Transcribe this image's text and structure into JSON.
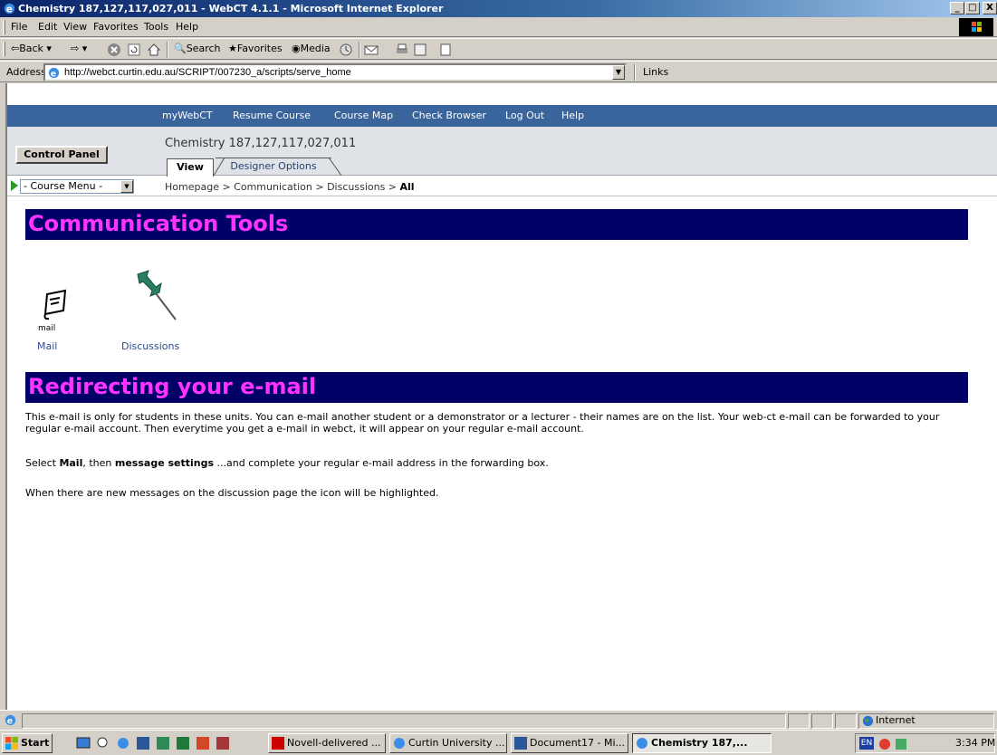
{
  "window": {
    "title": "Chemistry 187,127,117,027,011 - WebCT 4.1.1 - Microsoft Internet Explorer",
    "controls": [
      "_",
      "□",
      "X"
    ]
  },
  "menubar": [
    "File",
    "Edit",
    "View",
    "Favorites",
    "Tools",
    "Help"
  ],
  "toolbar": {
    "back": "Back",
    "search": "Search",
    "favorites": "Favorites",
    "media": "Media"
  },
  "address": {
    "label": "Address",
    "url": "http://webct.curtin.edu.au/SCRIPT/007230_a/scripts/serve_home",
    "links": "Links"
  },
  "webct_nav": [
    "myWebCT",
    "Resume Course",
    "Course Map",
    "Check Browser",
    "Log Out",
    "Help"
  ],
  "header": {
    "control_panel": "Control Panel",
    "course_name": "Chemistry 187,127,117,027,011",
    "tab_view": "View",
    "tab_designer": "Designer Options"
  },
  "course_menu": "- Course Menu -",
  "breadcrumb": {
    "path": "Homepage > Communication > Discussions > ",
    "current": "All"
  },
  "section1": {
    "title": "Communication Tools"
  },
  "tools": {
    "mail_caption": "mail",
    "mail": "Mail",
    "discussions": "Discussions"
  },
  "section2": {
    "title": "Redirecting your e-mail"
  },
  "body": {
    "p1": "This e-mail is only for students in these units. You can e-mail another student or a demonstrator or a lecturer - their names are on the list. Your web-ct e-mail can be forwarded to your regular e-mail account. Then everytime you get a e-mail in webct, it will appear on your regular e-mail account.",
    "p2_a": "Select ",
    "p2_b": "Mail",
    "p2_c": ", then ",
    "p2_d": "message settings",
    "p2_e": " ...and complete your regular e-mail address in the forwarding box.",
    "p3": "When there are new messages on the discussion page the icon will be highlighted."
  },
  "status": {
    "zone": "Internet"
  },
  "taskbar": {
    "start": "Start",
    "buttons": [
      "Novell-delivered ...",
      "Curtin University ...",
      "Document17 - Mi...",
      "Chemistry 187,..."
    ],
    "clock": "3:34 PM",
    "lang": "EN"
  },
  "colors": {
    "section_bg": "#000066",
    "section_text": "#ff33ff",
    "nav_bg": "#39649c",
    "link": "#2c4a8c"
  }
}
